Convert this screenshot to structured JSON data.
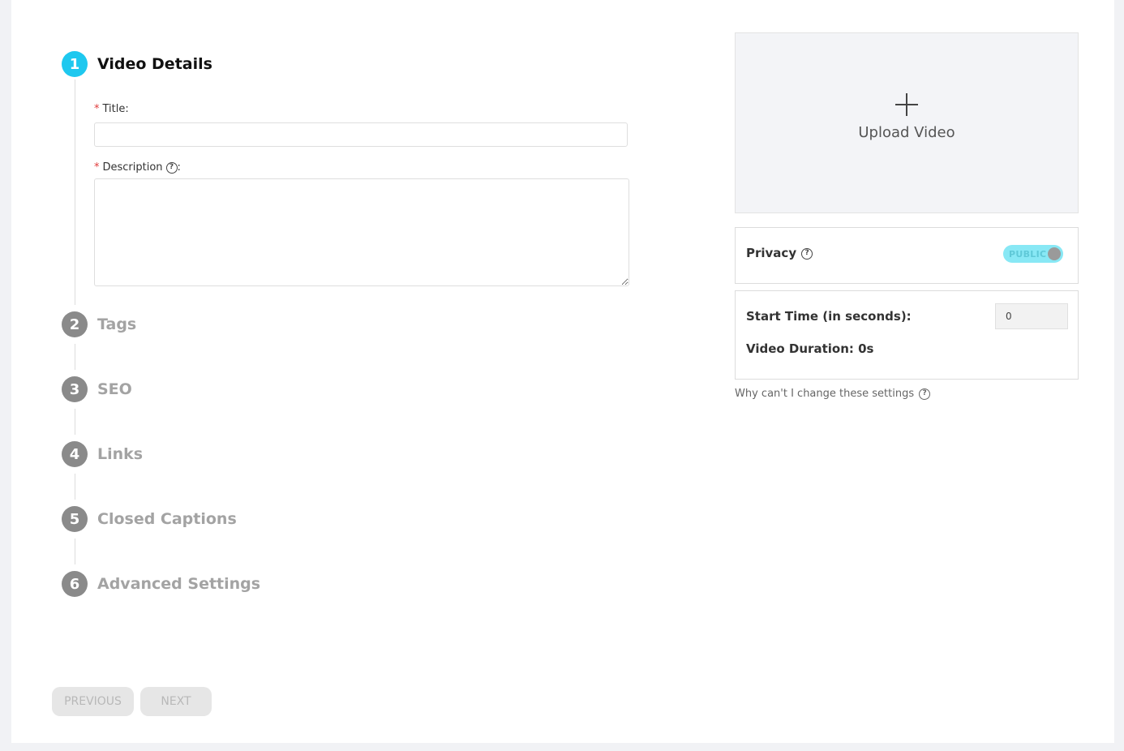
{
  "steps": [
    {
      "number": "1",
      "label": "Video Details",
      "active": true
    },
    {
      "number": "2",
      "label": "Tags",
      "active": false
    },
    {
      "number": "3",
      "label": "SEO",
      "active": false
    },
    {
      "number": "4",
      "label": "Links",
      "active": false
    },
    {
      "number": "5",
      "label": "Closed Captions",
      "active": false
    },
    {
      "number": "6",
      "label": "Advanced Settings",
      "active": false
    }
  ],
  "form": {
    "required_mark": "*",
    "title_label": "Title",
    "title_value": "",
    "description_label": "Description",
    "description_value": "",
    "colon": ":"
  },
  "buttons": {
    "previous": "PREVIOUS",
    "next": "NEXT"
  },
  "upload": {
    "label": "Upload Video",
    "icon": "plus-icon"
  },
  "privacy": {
    "label": "Privacy",
    "toggle_text": "PUBLIC",
    "toggle_color": "#88e8f5"
  },
  "timing": {
    "start_label": "Start Time (in seconds):",
    "start_value": "0",
    "duration_label": "Video Duration: 0s"
  },
  "help_text": "Why can't I change these settings",
  "help_icon_glyph": "?",
  "colors": {
    "accent": "#1ec8ef",
    "inactive_step": "#8a8a8a"
  }
}
